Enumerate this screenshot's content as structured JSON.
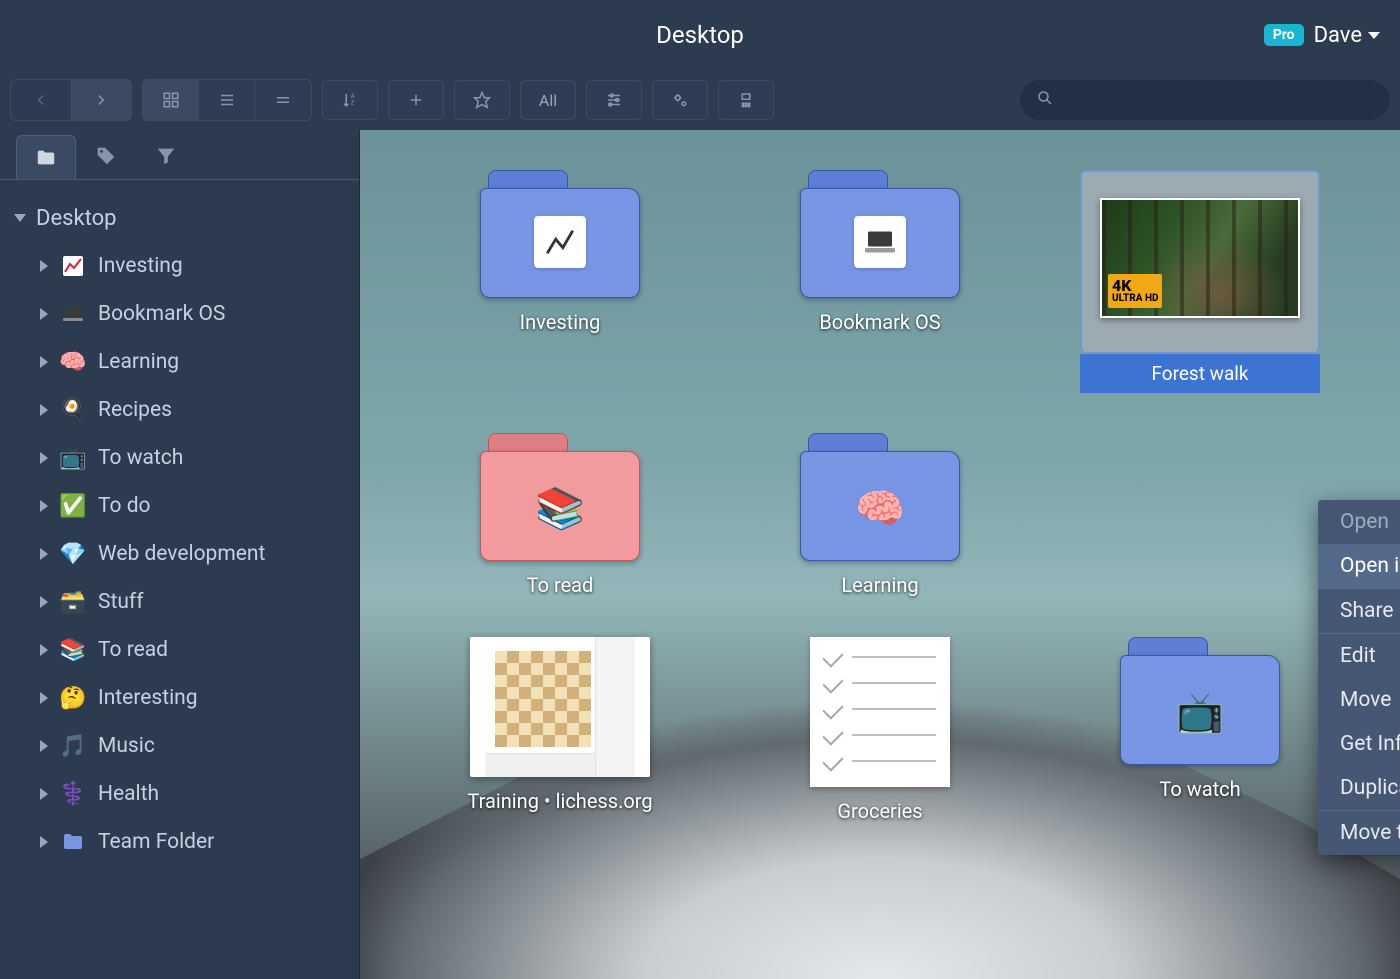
{
  "titlebar": {
    "title": "Desktop",
    "pro": "Pro",
    "user": "Dave"
  },
  "toolbar": {
    "filter_label": "All"
  },
  "search": {
    "placeholder": ""
  },
  "sidebar": {
    "root_label": "Desktop",
    "items": [
      {
        "emoji": "chart-up",
        "label": "Investing"
      },
      {
        "emoji": "laptop",
        "label": "Bookmark OS"
      },
      {
        "emoji": "brain",
        "label": "Learning"
      },
      {
        "emoji": "egg",
        "label": "Recipes"
      },
      {
        "emoji": "tv",
        "label": "To watch"
      },
      {
        "emoji": "check",
        "label": "To do"
      },
      {
        "emoji": "gem",
        "label": "Web development"
      },
      {
        "emoji": "box",
        "label": "Stuff"
      },
      {
        "emoji": "books",
        "label": "To read"
      },
      {
        "emoji": "thinking",
        "label": "Interesting"
      },
      {
        "emoji": "music",
        "label": "Music"
      },
      {
        "emoji": "medical",
        "label": "Health"
      },
      {
        "emoji": "folder",
        "label": "Team Folder"
      }
    ]
  },
  "desktop": {
    "items": [
      {
        "kind": "folder",
        "color": "blue",
        "inner": "chart-icon",
        "label": "Investing"
      },
      {
        "kind": "folder",
        "color": "blue",
        "inner": "laptop-icon",
        "label": "Bookmark OS"
      },
      {
        "kind": "thumb-forest",
        "label": "Forest walk",
        "selected": true,
        "badge": {
          "big": "4K",
          "small": "ULTRA HD"
        }
      },
      {
        "kind": "folder",
        "color": "pink",
        "inner": "books-emoji",
        "label": "To read"
      },
      {
        "kind": "folder",
        "color": "blue",
        "inner": "brain-emoji",
        "label": "Learning"
      },
      {
        "kind": "folder-partial",
        "color": "blue",
        "inner": "tv-emoji",
        "label": "To watch"
      },
      {
        "kind": "thumb-chess",
        "label": "Training • lichess.org"
      },
      {
        "kind": "thumb-note",
        "label": "Groceries"
      }
    ]
  },
  "context_menu": {
    "items": [
      {
        "label": "Open",
        "dim": true
      },
      {
        "label": "Open in new tab",
        "highlight": true
      },
      {
        "sep": true
      },
      {
        "label": "Share"
      },
      {
        "sep": true
      },
      {
        "label": "Edit"
      },
      {
        "label": "Move"
      },
      {
        "label": "Get Info"
      },
      {
        "label": "Duplicate"
      },
      {
        "sep": true
      },
      {
        "label": "Move to Trash"
      }
    ]
  }
}
